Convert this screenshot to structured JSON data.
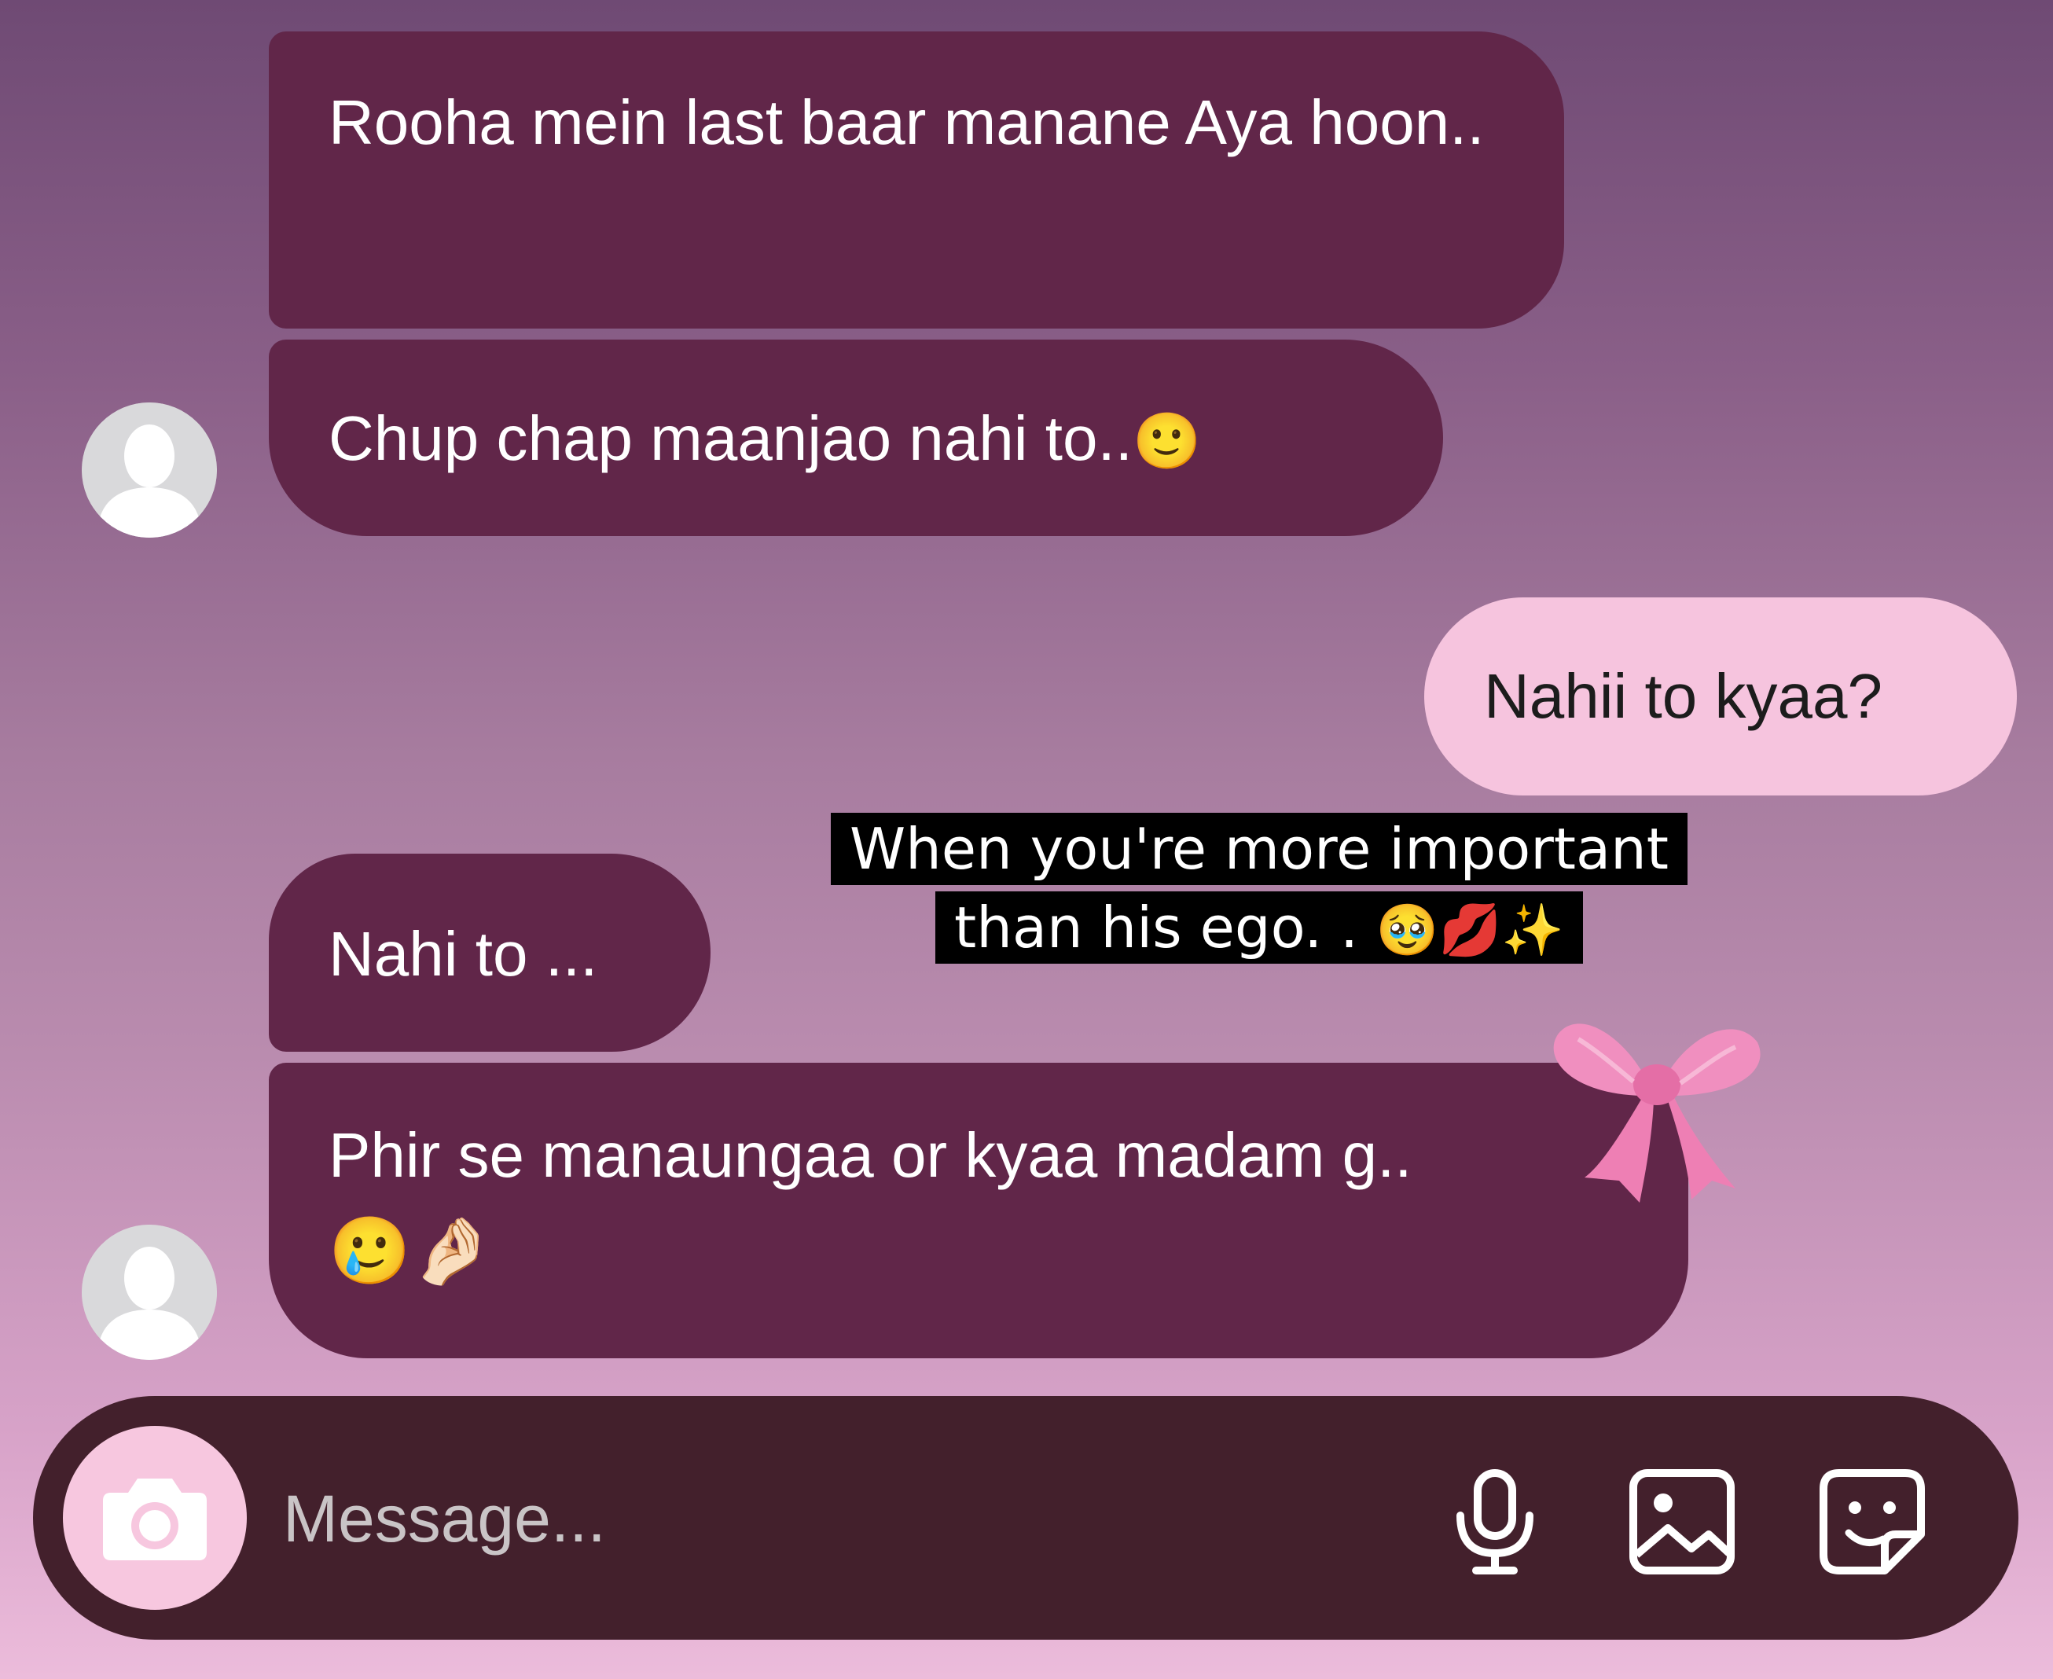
{
  "messages": [
    {
      "text": "Rooha mein last baar manane Aya hoon..",
      "emoji": ""
    },
    {
      "text": "Chup chap maanjao nahi to..",
      "emoji": "🙂"
    },
    {
      "text": "Nahii to kyaa?",
      "emoji": ""
    },
    {
      "text": "Nahi to ...",
      "emoji": ""
    },
    {
      "text": "Phir se manaungaa or kyaa madam g..",
      "emoji": "🥲🤌🏻"
    }
  ],
  "caption": {
    "line1": "When you're more important",
    "line2": "than his ego. .",
    "line2_emoji": "🥹💋✨"
  },
  "composer": {
    "placeholder": "Message..."
  },
  "icons": {
    "avatar": "default-avatar-icon",
    "bow": "pink-bow-sticker",
    "camera": "camera-icon",
    "mic": "microphone-icon",
    "gallery": "image-icon",
    "sticker": "sticker-icon"
  },
  "colors": {
    "received_bubble": "#612649",
    "sent_bubble": "#f6c4de",
    "composer_bg": "#43202c",
    "camera_button": "#f7c7df"
  }
}
